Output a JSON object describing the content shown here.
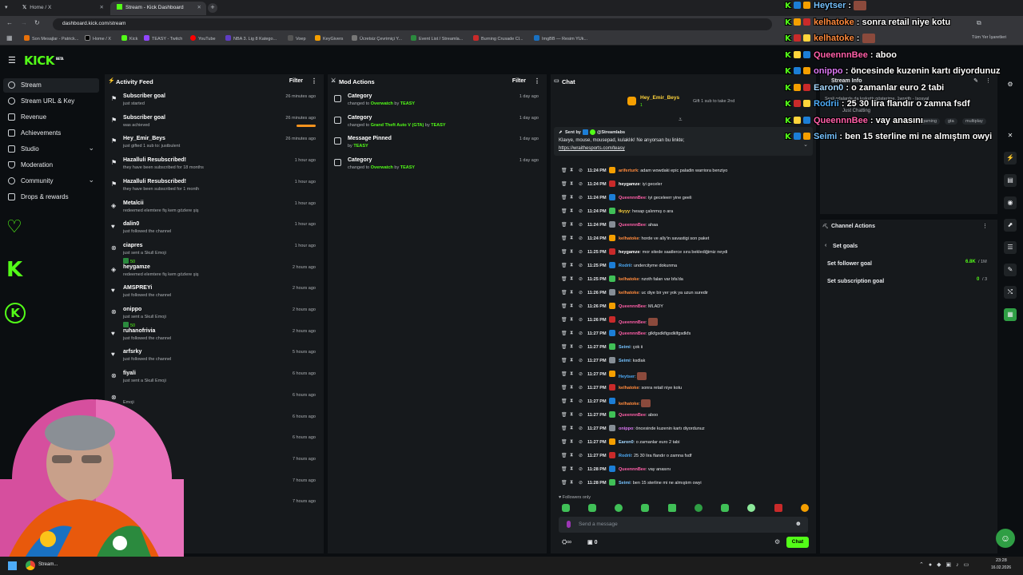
{
  "browser": {
    "tabs": [
      {
        "label": "Home / X"
      },
      {
        "label": "Stream - Kick Dashboard"
      }
    ],
    "url": "dashboard.kick.com/stream",
    "bookmarks": [
      "Son Mesajlar - Patrick...",
      "Home / X",
      "Kick",
      "TEASY - Twitch",
      "YouTube",
      "NBA 3. Lig 8 Katego...",
      "Voep",
      "KeyGivers",
      "Ücretsiz Çevrimiçi Y...",
      "Event List / Streamla...",
      "Burning Crusade Cl...",
      "ImgBB — Resim YUk..."
    ],
    "all_bookmarks": "Tüm Yer İşaretleri"
  },
  "kick": {
    "logo": "KICK",
    "beta": "BETA"
  },
  "sidebar": {
    "items": [
      {
        "label": "Stream"
      },
      {
        "label": "Stream URL & Key"
      },
      {
        "label": "Revenue"
      },
      {
        "label": "Achievements"
      },
      {
        "label": "Studio"
      },
      {
        "label": "Moderation"
      },
      {
        "label": "Community"
      },
      {
        "label": "Drops & rewards"
      }
    ]
  },
  "activity": {
    "title": "Activity Feed",
    "filter": "Filter",
    "items": [
      {
        "title": "Subscriber goal",
        "sub": "just started",
        "time": "26 minutes ago"
      },
      {
        "title": "Subscriber goal",
        "sub": "was achieved",
        "time": "26 minutes ago"
      },
      {
        "title": "Hey_Emir_Beys",
        "sub": "just gifted 1 sub to: justbulent",
        "time": "26 minutes ago"
      },
      {
        "title": "Hazalluli Resubscribed!",
        "sub": "they have been subscribed for 18 months",
        "time": "1 hour ago"
      },
      {
        "title": "Hazalluli Resubscribed!",
        "sub": "they have been subscribed for 1 month",
        "time": "1 hour ago"
      },
      {
        "title": "Metalcii",
        "sub": "redeemed elemtere fiş kem gözlere şiş",
        "time": "1 hour ago"
      },
      {
        "title": "dalin0",
        "sub": "just followed the channel",
        "time": "1 hour ago"
      },
      {
        "title": "ciapres",
        "sub": "just sent a Skull Emoji",
        "extra": "50",
        "time": "1 hour ago"
      },
      {
        "title": "heygamze",
        "sub": "redeemed elemtere fiş kem gözlere şiş",
        "time": "2 hours ago"
      },
      {
        "title": "AMSPREYi",
        "sub": "just followed the channel",
        "time": "2 hours ago"
      },
      {
        "title": "onippo",
        "sub": "just sent a Skull Emoji",
        "extra": "50",
        "time": "2 hours ago"
      },
      {
        "title": "ruhanofrivia",
        "sub": "just followed the channel",
        "time": "2 hours ago"
      },
      {
        "title": "arfsrky",
        "sub": "just followed the channel",
        "time": "5 hours ago"
      },
      {
        "title": "fiyali",
        "sub": "just sent a Skull Emoji",
        "time": "6 hours ago"
      },
      {
        "title": "",
        "sub": "Emoji",
        "time": "6 hours ago"
      },
      {
        "title": "",
        "sub": "",
        "time": "6 hours ago"
      },
      {
        "title": "",
        "sub": "",
        "time": "6 hours ago"
      },
      {
        "title": "",
        "sub": "el",
        "time": "7 hours ago"
      },
      {
        "title": "",
        "sub": "el",
        "time": "7 hours ago"
      },
      {
        "title": "",
        "sub": "upple",
        "time": "7 hours ago"
      }
    ]
  },
  "modactions": {
    "title": "Mod Actions",
    "filter": "Filter",
    "items": [
      {
        "title": "Category",
        "pre": "changed to",
        "target": "Overwatch",
        "by": "by",
        "who": "TEASY",
        "time": "1 day ago"
      },
      {
        "title": "Category",
        "pre": "changed to",
        "target": "Grand Theft Auto V (GTA)",
        "by": "by",
        "who": "TEASY",
        "time": "1 day ago"
      },
      {
        "title": "Message Pinned",
        "pre": "by",
        "target": "TEASY",
        "by": "",
        "who": "",
        "time": "1 day ago"
      },
      {
        "title": "Category",
        "pre": "changed to",
        "target": "Overwatch",
        "by": "by",
        "who": "TEASY",
        "time": "1 day ago"
      }
    ]
  },
  "chat": {
    "title": "Chat",
    "gift_user": "Hey_Emir_Beys",
    "gift_count": "1",
    "gift_text": "Gift 1 sub to take 2nd",
    "pinned_sent_by": "Sent by",
    "pinned_author": "@Streamlabs",
    "pinned_text": "Klavye, mouse, mousepad, kulaklık! Ne arıyorsan bu linkte;",
    "pinned_link": "https://wraithesports.com/teasy",
    "followers_only": "Followers only",
    "input_placeholder": "Send a message",
    "send_label": "Chat",
    "viewer_count": "0",
    "messages": [
      {
        "time": "11:24 PM",
        "user": "ariferturk",
        "color": "#ff8a3d",
        "text": "adam wowdaki epic paladin warriora benziyo"
      },
      {
        "time": "11:24 PM",
        "user": "heygamze",
        "color": "#ffffff",
        "text": "iyi geceler"
      },
      {
        "time": "11:24 PM",
        "user": "QueennnBee",
        "color": "#ff5fa8",
        "text": "iyi geceleerr yine geeli"
      },
      {
        "time": "11:24 PM",
        "user": "tkyyy",
        "color": "#ffd43b",
        "text": "hesap çalınmış o ara"
      },
      {
        "time": "11:24 PM",
        "user": "QueennnBee",
        "color": "#ff5fa8",
        "text": "ahaa"
      },
      {
        "time": "11:24 PM",
        "user": "kelhatoke",
        "color": "#ff8a3d",
        "text": "horde ve ally'in savastigi son paket"
      },
      {
        "time": "11:25 PM",
        "user": "heygamze",
        "color": "#ffffff",
        "text": "mor sitede saatlerce sıra beklediğimiz neydi"
      },
      {
        "time": "11:25 PM",
        "user": "Rodrii",
        "color": "#4dabf7",
        "text": "undercityme dokunma"
      },
      {
        "time": "11:25 PM",
        "user": "kelhatoke",
        "color": "#ff8a3d",
        "text": "nzoth falan var bfa'da"
      },
      {
        "time": "11:26 PM",
        "user": "kelhatoke",
        "color": "#ff8a3d",
        "text": "uc diye bir yer yok ya uzun suredir"
      },
      {
        "time": "11:26 PM",
        "user": "QueennnBee",
        "color": "#ff5fa8",
        "text": "MLADY"
      },
      {
        "time": "11:26 PM",
        "user": "QueennnBee",
        "color": "#ff5fa8",
        "text": ""
      },
      {
        "time": "11:27 PM",
        "user": "QueennnBee",
        "color": "#ff5fa8",
        "text": "glkfgsdkfigsdklfgsdkfs"
      },
      {
        "time": "11:27 PM",
        "user": "Seimi",
        "color": "#74c0fc",
        "text": "çok ii"
      },
      {
        "time": "11:27 PM",
        "user": "Seimi",
        "color": "#74c0fc",
        "text": "ksdlak"
      },
      {
        "time": "11:27 PM",
        "user": "Heytser",
        "color": "#4dabf7",
        "text": ""
      },
      {
        "time": "11:27 PM",
        "user": "kelhatoke",
        "color": "#ff8a3d",
        "text": "sonra retail niye kotu"
      },
      {
        "time": "11:27 PM",
        "user": "kelhatoke",
        "color": "#ff8a3d",
        "text": ""
      },
      {
        "time": "11:27 PM",
        "user": "QueennnBee",
        "color": "#ff5fa8",
        "text": "aboo"
      },
      {
        "time": "11:27 PM",
        "user": "onippo",
        "color": "#da77f2",
        "text": "öncesinde kuzenin kartı diyordunuz"
      },
      {
        "time": "11:27 PM",
        "user": "Earon0",
        "color": "#a5d8ff",
        "text": "o zamanlar euro 2 tabi"
      },
      {
        "time": "11:27 PM",
        "user": "Rodrii",
        "color": "#4dabf7",
        "text": "25 30 lira flandır o zamna fsdf"
      },
      {
        "time": "11:28 PM",
        "user": "QueennnBee",
        "color": "#ff5fa8",
        "text": "vay anasını"
      },
      {
        "time": "11:28 PM",
        "user": "Seimi",
        "color": "#74c0fc",
        "text": "ben 15 sterline mi ne almıştım owyi"
      }
    ]
  },
  "streaminfo": {
    "title": "Stream Info",
    "stream_title": "Sesli odalarda da kışkırttı gösterime. 1wraith - Isosyal",
    "category": "Just Chatting",
    "tags": [
      "gaming",
      "gta",
      "multiplay"
    ]
  },
  "channel_actions": {
    "title": "Channel Actions",
    "back": "Set goals",
    "goals": [
      {
        "label": "Set follower goal",
        "value": "6.8K",
        "max": "/ 1M"
      },
      {
        "label": "Set subscription goal",
        "value": "0",
        "max": "/ 3"
      }
    ]
  },
  "overlay": {
    "rows": [
      {
        "user": "Heytser",
        "color": "#74c0fc",
        "text": ""
      },
      {
        "user": "kelhatoke",
        "color": "#ff8a3d",
        "text": "sonra retail niye kotu"
      },
      {
        "user": "kelhatoke",
        "color": "#ff8a3d",
        "text": ""
      },
      {
        "user": "QueennnBee",
        "color": "#ff5fa8",
        "text": "aboo"
      },
      {
        "user": "onippo",
        "color": "#da77f2",
        "text": "öncesinde kuzenin kartı diyordunuz"
      },
      {
        "user": "Earon0",
        "color": "#a5d8ff",
        "text": "o zamanlar euro 2 tabi"
      },
      {
        "user": "Rodrii",
        "color": "#4dabf7",
        "text": "25 30 lira flandır o zamna fsdf"
      },
      {
        "user": "QueennnBee",
        "color": "#ff5fa8",
        "text": "vay anasını"
      },
      {
        "user": "Seimi",
        "color": "#74c0fc",
        "text": "ben 15 sterline mi ne almıştım owyi"
      }
    ]
  },
  "taskbar": {
    "app_label": "Stream...",
    "time": "23:28",
    "date": "16.02.2026"
  },
  "colors": {
    "accent": "#53fc18",
    "bg": "#0b0e11",
    "panel": "#16191c"
  }
}
